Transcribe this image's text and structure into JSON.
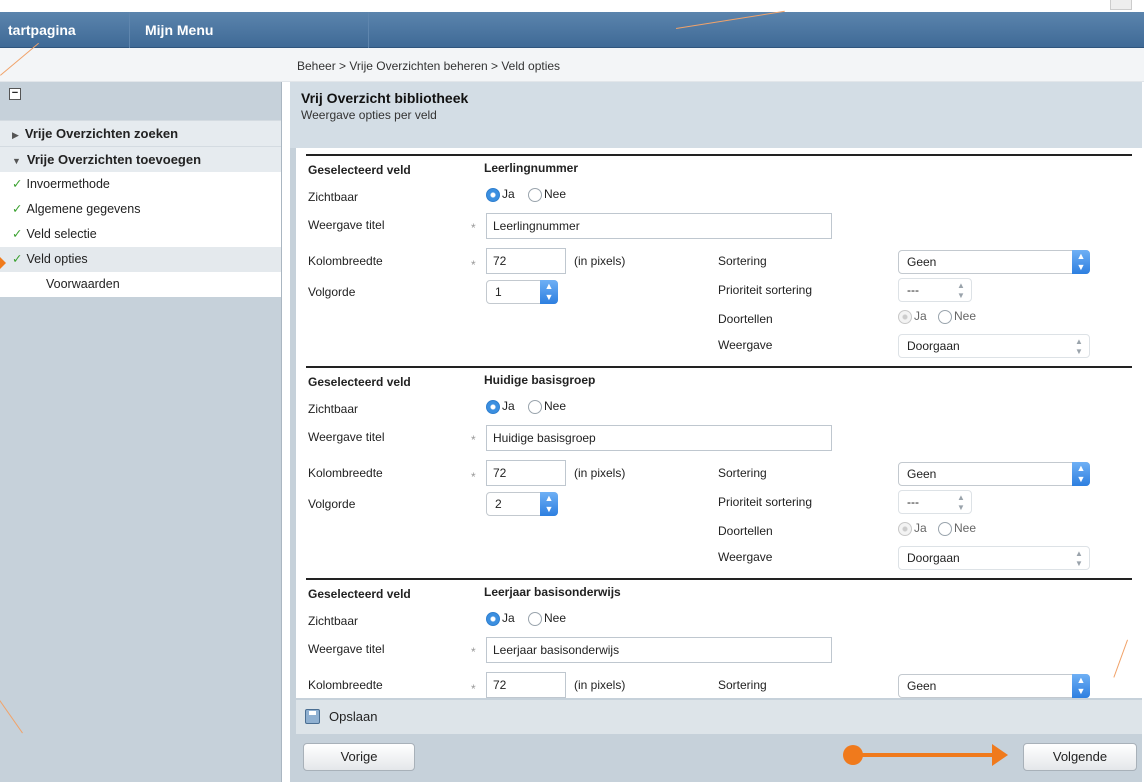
{
  "topnav": {
    "tab1": "tartpagina",
    "tab2": "Mijn Menu"
  },
  "breadcrumb": "Beheer > Vrije Overzichten beheren > Veld opties",
  "sidebar": {
    "collapse_symbol": "−",
    "groups": [
      {
        "label": "Vrije Overzichten zoeken",
        "expanded": false
      },
      {
        "label": "Vrije Overzichten toevoegen",
        "expanded": true
      }
    ],
    "items": [
      {
        "label": "Invoermethode",
        "done": true
      },
      {
        "label": "Algemene gegevens",
        "done": true
      },
      {
        "label": "Veld selectie",
        "done": true
      },
      {
        "label": "Veld opties",
        "done": true,
        "active": true
      },
      {
        "label": "Voorwaarden",
        "done": false
      }
    ]
  },
  "panel": {
    "title": "Vrij Overzicht bibliotheek",
    "subtitle": "Weergave opties per veld"
  },
  "labels": {
    "selected_field": "Geselecteerd veld",
    "visible": "Zichtbaar",
    "display_title": "Weergave titel",
    "column_width": "Kolombreedte",
    "in_pixels": "(in pixels)",
    "order": "Volgorde",
    "sorting": "Sortering",
    "sort_priority": "Prioriteit sortering",
    "count_through": "Doortellen",
    "display": "Weergave",
    "yes": "Ja",
    "no": "Nee",
    "required_mark": "*"
  },
  "fields": [
    {
      "name": "Leerlingnummer",
      "visible": "Ja",
      "title": "Leerlingnummer",
      "width": "72",
      "order": "1",
      "sorting": "Geen",
      "priority": "---",
      "count": "Ja",
      "display": "Doorgaan"
    },
    {
      "name": "Huidige basisgroep",
      "visible": "Ja",
      "title": "Huidige basisgroep",
      "width": "72",
      "order": "2",
      "sorting": "Geen",
      "priority": "---",
      "count": "Ja",
      "display": "Doorgaan"
    },
    {
      "name": "Leerjaar basisonderwijs",
      "visible": "Ja",
      "title": "Leerjaar basisonderwijs",
      "width": "72",
      "sorting": "Geen"
    }
  ],
  "save_label": "Opslaan",
  "prev_label": "Vorige",
  "next_label": "Volgende",
  "colors": {
    "accent": "#3f6a96",
    "annotation": "#f07a1c",
    "check": "#3aa12f"
  }
}
